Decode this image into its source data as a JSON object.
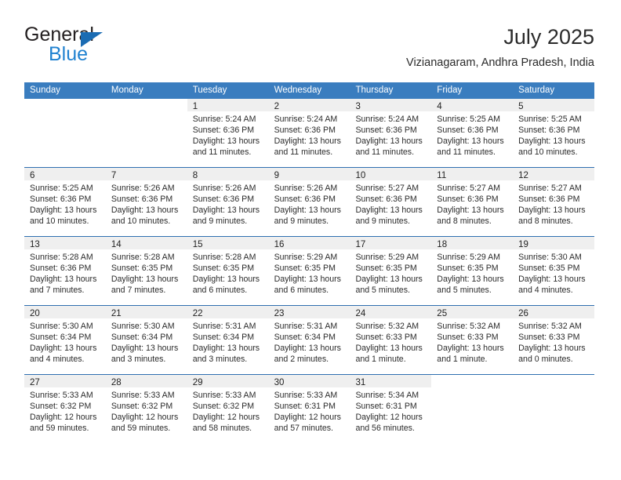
{
  "brand": {
    "name_top": "General",
    "name_bottom": "Blue",
    "triangle_color": "#1b6cb3",
    "blue_text_color": "#1f81d0"
  },
  "header": {
    "month_title": "July 2025",
    "location": "Vizianagaram, Andhra Pradesh, India"
  },
  "theme": {
    "header_blue": "#3a7dbf",
    "separator_blue": "#2f6fb0",
    "daynum_band_gray": "#efefef"
  },
  "calendar": {
    "weekdays": [
      "Sunday",
      "Monday",
      "Tuesday",
      "Wednesday",
      "Thursday",
      "Friday",
      "Saturday"
    ],
    "weeks": [
      [
        {
          "day": "",
          "lines": []
        },
        {
          "day": "",
          "lines": []
        },
        {
          "day": "1",
          "lines": [
            "Sunrise: 5:24 AM",
            "Sunset: 6:36 PM",
            "Daylight: 13 hours",
            "and 11 minutes."
          ]
        },
        {
          "day": "2",
          "lines": [
            "Sunrise: 5:24 AM",
            "Sunset: 6:36 PM",
            "Daylight: 13 hours",
            "and 11 minutes."
          ]
        },
        {
          "day": "3",
          "lines": [
            "Sunrise: 5:24 AM",
            "Sunset: 6:36 PM",
            "Daylight: 13 hours",
            "and 11 minutes."
          ]
        },
        {
          "day": "4",
          "lines": [
            "Sunrise: 5:25 AM",
            "Sunset: 6:36 PM",
            "Daylight: 13 hours",
            "and 11 minutes."
          ]
        },
        {
          "day": "5",
          "lines": [
            "Sunrise: 5:25 AM",
            "Sunset: 6:36 PM",
            "Daylight: 13 hours",
            "and 10 minutes."
          ]
        }
      ],
      [
        {
          "day": "6",
          "lines": [
            "Sunrise: 5:25 AM",
            "Sunset: 6:36 PM",
            "Daylight: 13 hours",
            "and 10 minutes."
          ]
        },
        {
          "day": "7",
          "lines": [
            "Sunrise: 5:26 AM",
            "Sunset: 6:36 PM",
            "Daylight: 13 hours",
            "and 10 minutes."
          ]
        },
        {
          "day": "8",
          "lines": [
            "Sunrise: 5:26 AM",
            "Sunset: 6:36 PM",
            "Daylight: 13 hours",
            "and 9 minutes."
          ]
        },
        {
          "day": "9",
          "lines": [
            "Sunrise: 5:26 AM",
            "Sunset: 6:36 PM",
            "Daylight: 13 hours",
            "and 9 minutes."
          ]
        },
        {
          "day": "10",
          "lines": [
            "Sunrise: 5:27 AM",
            "Sunset: 6:36 PM",
            "Daylight: 13 hours",
            "and 9 minutes."
          ]
        },
        {
          "day": "11",
          "lines": [
            "Sunrise: 5:27 AM",
            "Sunset: 6:36 PM",
            "Daylight: 13 hours",
            "and 8 minutes."
          ]
        },
        {
          "day": "12",
          "lines": [
            "Sunrise: 5:27 AM",
            "Sunset: 6:36 PM",
            "Daylight: 13 hours",
            "and 8 minutes."
          ]
        }
      ],
      [
        {
          "day": "13",
          "lines": [
            "Sunrise: 5:28 AM",
            "Sunset: 6:36 PM",
            "Daylight: 13 hours",
            "and 7 minutes."
          ]
        },
        {
          "day": "14",
          "lines": [
            "Sunrise: 5:28 AM",
            "Sunset: 6:35 PM",
            "Daylight: 13 hours",
            "and 7 minutes."
          ]
        },
        {
          "day": "15",
          "lines": [
            "Sunrise: 5:28 AM",
            "Sunset: 6:35 PM",
            "Daylight: 13 hours",
            "and 6 minutes."
          ]
        },
        {
          "day": "16",
          "lines": [
            "Sunrise: 5:29 AM",
            "Sunset: 6:35 PM",
            "Daylight: 13 hours",
            "and 6 minutes."
          ]
        },
        {
          "day": "17",
          "lines": [
            "Sunrise: 5:29 AM",
            "Sunset: 6:35 PM",
            "Daylight: 13 hours",
            "and 5 minutes."
          ]
        },
        {
          "day": "18",
          "lines": [
            "Sunrise: 5:29 AM",
            "Sunset: 6:35 PM",
            "Daylight: 13 hours",
            "and 5 minutes."
          ]
        },
        {
          "day": "19",
          "lines": [
            "Sunrise: 5:30 AM",
            "Sunset: 6:35 PM",
            "Daylight: 13 hours",
            "and 4 minutes."
          ]
        }
      ],
      [
        {
          "day": "20",
          "lines": [
            "Sunrise: 5:30 AM",
            "Sunset: 6:34 PM",
            "Daylight: 13 hours",
            "and 4 minutes."
          ]
        },
        {
          "day": "21",
          "lines": [
            "Sunrise: 5:30 AM",
            "Sunset: 6:34 PM",
            "Daylight: 13 hours",
            "and 3 minutes."
          ]
        },
        {
          "day": "22",
          "lines": [
            "Sunrise: 5:31 AM",
            "Sunset: 6:34 PM",
            "Daylight: 13 hours",
            "and 3 minutes."
          ]
        },
        {
          "day": "23",
          "lines": [
            "Sunrise: 5:31 AM",
            "Sunset: 6:34 PM",
            "Daylight: 13 hours",
            "and 2 minutes."
          ]
        },
        {
          "day": "24",
          "lines": [
            "Sunrise: 5:32 AM",
            "Sunset: 6:33 PM",
            "Daylight: 13 hours",
            "and 1 minute."
          ]
        },
        {
          "day": "25",
          "lines": [
            "Sunrise: 5:32 AM",
            "Sunset: 6:33 PM",
            "Daylight: 13 hours",
            "and 1 minute."
          ]
        },
        {
          "day": "26",
          "lines": [
            "Sunrise: 5:32 AM",
            "Sunset: 6:33 PM",
            "Daylight: 13 hours",
            "and 0 minutes."
          ]
        }
      ],
      [
        {
          "day": "27",
          "lines": [
            "Sunrise: 5:33 AM",
            "Sunset: 6:32 PM",
            "Daylight: 12 hours",
            "and 59 minutes."
          ]
        },
        {
          "day": "28",
          "lines": [
            "Sunrise: 5:33 AM",
            "Sunset: 6:32 PM",
            "Daylight: 12 hours",
            "and 59 minutes."
          ]
        },
        {
          "day": "29",
          "lines": [
            "Sunrise: 5:33 AM",
            "Sunset: 6:32 PM",
            "Daylight: 12 hours",
            "and 58 minutes."
          ]
        },
        {
          "day": "30",
          "lines": [
            "Sunrise: 5:33 AM",
            "Sunset: 6:31 PM",
            "Daylight: 12 hours",
            "and 57 minutes."
          ]
        },
        {
          "day": "31",
          "lines": [
            "Sunrise: 5:34 AM",
            "Sunset: 6:31 PM",
            "Daylight: 12 hours",
            "and 56 minutes."
          ]
        },
        {
          "day": "",
          "lines": []
        },
        {
          "day": "",
          "lines": []
        }
      ]
    ]
  }
}
